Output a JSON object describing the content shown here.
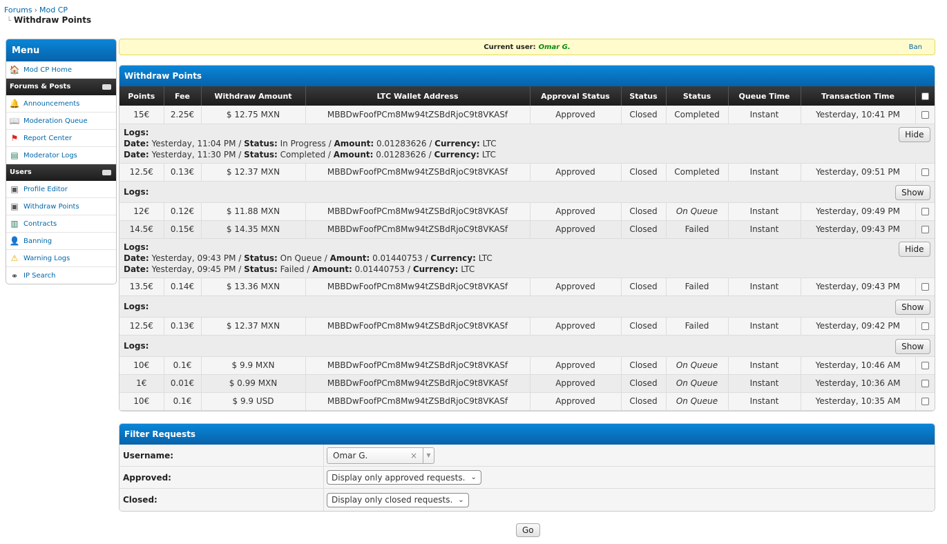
{
  "breadcrumb": {
    "item1": "Forums",
    "item2": "Mod CP",
    "title": "Withdraw Points"
  },
  "sidebar": {
    "title": "Menu",
    "sections": [
      {
        "title": "",
        "items": [
          {
            "label": "Mod CP Home",
            "icon": "home-icon"
          }
        ]
      },
      {
        "title": "Forums & Posts",
        "items": [
          {
            "label": "Announcements",
            "icon": "bell-icon"
          },
          {
            "label": "Moderation Queue",
            "icon": "book-icon"
          },
          {
            "label": "Report Center",
            "icon": "flag-icon"
          },
          {
            "label": "Moderator Logs",
            "icon": "log-icon"
          }
        ]
      },
      {
        "title": "Users",
        "items": [
          {
            "label": "Profile Editor",
            "icon": "profile-card-icon"
          },
          {
            "label": "Withdraw Points",
            "icon": "profile-card-icon"
          },
          {
            "label": "Contracts",
            "icon": "document-icon"
          },
          {
            "label": "Banning",
            "icon": "user-icon"
          },
          {
            "label": "Warning Logs",
            "icon": "warning-icon"
          },
          {
            "label": "IP Search",
            "icon": "binoculars-icon"
          }
        ]
      }
    ]
  },
  "userbar": {
    "label": "Current user:",
    "name": "Omar G.",
    "ban": "Ban"
  },
  "withdraw": {
    "title": "Withdraw Points",
    "headers": [
      "Points",
      "Fee",
      "Withdraw Amount",
      "LTC Wallet Address",
      "Approval Status",
      "Status",
      "Status",
      "Queue Time",
      "Transaction Time"
    ],
    "rows": [
      {
        "points": "15€",
        "fee": "2.25€",
        "amount": "$ 12.75 MXN",
        "wallet": "MBBDwFoofPCm8Mw94tZSBdRjoC9t8VKASf",
        "approval": "Approved",
        "status": "Closed",
        "state": "Completed",
        "queue": "Instant",
        "time": "Yesterday, 10:41 PM"
      },
      {
        "points": "12.5€",
        "fee": "0.13€",
        "amount": "$ 12.37 MXN",
        "wallet": "MBBDwFoofPCm8Mw94tZSBdRjoC9t8VKASf",
        "approval": "Approved",
        "status": "Closed",
        "state": "Completed",
        "queue": "Instant",
        "time": "Yesterday, 09:51 PM"
      },
      {
        "points": "12€",
        "fee": "0.12€",
        "amount": "$ 11.88 MXN",
        "wallet": "MBBDwFoofPCm8Mw94tZSBdRjoC9t8VKASf",
        "approval": "Approved",
        "status": "Closed",
        "state": "On Queue",
        "queue": "Instant",
        "time": "Yesterday, 09:49 PM"
      },
      {
        "points": "14.5€",
        "fee": "0.15€",
        "amount": "$ 14.35 MXN",
        "wallet": "MBBDwFoofPCm8Mw94tZSBdRjoC9t8VKASf",
        "approval": "Approved",
        "status": "Closed",
        "state": "Failed",
        "queue": "Instant",
        "time": "Yesterday, 09:43 PM"
      },
      {
        "points": "13.5€",
        "fee": "0.14€",
        "amount": "$ 13.36 MXN",
        "wallet": "MBBDwFoofPCm8Mw94tZSBdRjoC9t8VKASf",
        "approval": "Approved",
        "status": "Closed",
        "state": "Failed",
        "queue": "Instant",
        "time": "Yesterday, 09:43 PM"
      },
      {
        "points": "12.5€",
        "fee": "0.13€",
        "amount": "$ 12.37 MXN",
        "wallet": "MBBDwFoofPCm8Mw94tZSBdRjoC9t8VKASf",
        "approval": "Approved",
        "status": "Closed",
        "state": "Failed",
        "queue": "Instant",
        "time": "Yesterday, 09:42 PM"
      },
      {
        "points": "10€",
        "fee": "0.1€",
        "amount": "$ 9.9 MXN",
        "wallet": "MBBDwFoofPCm8Mw94tZSBdRjoC9t8VKASf",
        "approval": "Approved",
        "status": "Closed",
        "state": "On Queue",
        "queue": "Instant",
        "time": "Yesterday, 10:46 AM"
      },
      {
        "points": "1€",
        "fee": "0.01€",
        "amount": "$ 0.99 MXN",
        "wallet": "MBBDwFoofPCm8Mw94tZSBdRjoC9t8VKASf",
        "approval": "Approved",
        "status": "Closed",
        "state": "On Queue",
        "queue": "Instant",
        "time": "Yesterday, 10:36 AM"
      },
      {
        "points": "10€",
        "fee": "0.1€",
        "amount": "$ 9.9 USD",
        "wallet": "MBBDwFoofPCm8Mw94tZSBdRjoC9t8VKASf",
        "approval": "Approved",
        "status": "Closed",
        "state": "On Queue",
        "queue": "Instant",
        "time": "Yesterday, 10:35 AM"
      }
    ],
    "log_label": "Logs:",
    "log_keys": {
      "date": "Date:",
      "status": "Status:",
      "amount": "Amount:",
      "currency": "Currency:",
      "sep": " / "
    },
    "logs": {
      "row0": {
        "button": "Hide",
        "entries": [
          {
            "date": "Yesterday, 11:04 PM",
            "status": "In Progress",
            "amount": "0.01283626",
            "currency": "LTC"
          },
          {
            "date": "Yesterday, 11:30 PM",
            "status": "Completed",
            "amount": "0.01283626",
            "currency": "LTC"
          }
        ]
      },
      "row1": {
        "button": "Show"
      },
      "row3": {
        "button": "Hide",
        "entries": [
          {
            "date": "Yesterday, 09:43 PM",
            "status": "On Queue",
            "amount": "0.01440753",
            "currency": "LTC"
          },
          {
            "date": "Yesterday, 09:45 PM",
            "status": "Failed",
            "amount": "0.01440753",
            "currency": "LTC"
          }
        ]
      },
      "row4": {
        "button": "Show"
      },
      "row5": {
        "button": "Show"
      }
    }
  },
  "filter": {
    "title": "Filter Requests",
    "username_label": "Username:",
    "username_value": "Omar G.",
    "approved_label": "Approved:",
    "approved_value": "Display only approved requests.",
    "closed_label": "Closed:",
    "closed_value": "Display only closed requests."
  },
  "go_label": "Go",
  "colors": {
    "header_blue": "#0762a9",
    "completed": "#1a8a1a",
    "failed": "#cc0000",
    "userbar_bg": "#fffbcc"
  }
}
